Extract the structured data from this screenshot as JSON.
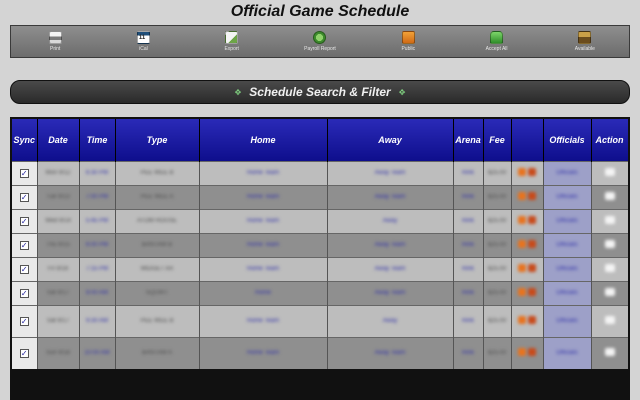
{
  "page": {
    "title": "Official Game Schedule"
  },
  "toolbar": {
    "buttons": [
      {
        "label": "Print",
        "icon": "print-icon"
      },
      {
        "label": "iCal",
        "icon": "calendar-icon"
      },
      {
        "label": "Export",
        "icon": "export-icon"
      },
      {
        "label": "Payroll Report",
        "icon": "payroll-icon"
      },
      {
        "label": "Public",
        "icon": "public-icon"
      },
      {
        "label": "Accept All",
        "icon": "thumbs-up-icon"
      },
      {
        "label": "Available",
        "icon": "briefcase-icon"
      }
    ]
  },
  "filter": {
    "title": "Schedule Search & Filter"
  },
  "table": {
    "headers": [
      "Sync",
      "Date",
      "Time",
      "Type",
      "Home",
      "Away",
      "Arena",
      "Fee",
      "",
      "Officials",
      "Action"
    ],
    "rows": [
      {
        "sync": "✓",
        "cells": [
          "Mon 9/12",
          "6:30 PM",
          "PEE WEE B",
          "Home Team",
          "Away Team",
          "Rink",
          "$25.00",
          "",
          "Officials",
          ""
        ]
      },
      {
        "sync": "✓",
        "cells": [
          "Tue 9/13",
          "7:00 PM",
          "PEE WEE A",
          "Home Team",
          "Away Team",
          "Rink",
          "$25.00",
          "",
          "Officials",
          ""
        ]
      },
      {
        "sync": "✓",
        "cells": [
          "Wed 9/14",
          "5:45 PM",
          "ATOM HOUSE",
          "Home Team",
          "Away",
          "Rink",
          "$25.00",
          "",
          "Officials",
          ""
        ]
      },
      {
        "sync": "✓",
        "cells": [
          "Thu 9/15",
          "6:00 PM",
          "BANTAM B",
          "Home Team",
          "Away Team",
          "Rink",
          "$25.00",
          "",
          "Officials",
          ""
        ]
      },
      {
        "sync": "✓",
        "cells": [
          "Fri 9/16",
          "7:15 PM",
          "MIDGET AA",
          "Home Team",
          "Away Team",
          "Rink",
          "$25.00",
          "",
          "Officials",
          ""
        ]
      },
      {
        "sync": "✓",
        "cells": [
          "Sat 9/17",
          "8:00 AM",
          "SQUIRT",
          "Home",
          "Away Team",
          "Rink",
          "$25.00",
          "",
          "Officials",
          ""
        ]
      },
      {
        "sync": "✓",
        "cells": [
          "Sat 9/17",
          "9:30 AM",
          "PEE WEE B",
          "Home Team",
          "Away",
          "Rink",
          "$25.00",
          "",
          "Officials",
          ""
        ]
      },
      {
        "sync": "✓",
        "cells": [
          "Sun 9/18",
          "10:00 AM",
          "BANTAM A",
          "Home Team",
          "Away Team",
          "Rink",
          "$25.00",
          "",
          "Officials",
          ""
        ]
      }
    ]
  },
  "colors": {
    "header_blue": "#0e0e8c",
    "toolbar_gray": "#7a7a7a",
    "filter_dark": "#333333"
  }
}
